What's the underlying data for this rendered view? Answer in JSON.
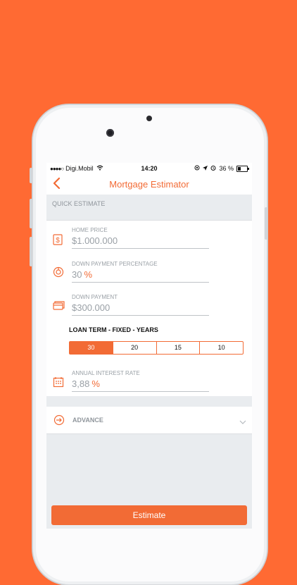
{
  "status": {
    "carrier": "Digi.Mobil",
    "time": "14:20",
    "battery": "36 %",
    "battery_level": 0.36
  },
  "nav": {
    "title": "Mortgage Estimator"
  },
  "quick_estimate": {
    "section_title": "QUICK ESTIMATE",
    "home_price": {
      "label": "HOME PRICE",
      "value": "$1.000.000"
    },
    "down_payment_percentage": {
      "label": "DOWN PAYMENT PERCENTAGE",
      "value": "30",
      "unit": "%"
    },
    "down_payment": {
      "label": "DOWN PAYMENT",
      "value": "$300.000"
    },
    "loan_term": {
      "title": "LOAN TERM - FIXED - YEARS",
      "options": [
        "30",
        "20",
        "15",
        "10"
      ],
      "selected": "30"
    },
    "interest_rate": {
      "label": "ANNUAL INTEREST RATE",
      "value": "3,88",
      "unit": "%"
    }
  },
  "advance": {
    "label": "ADVANCE"
  },
  "actions": {
    "estimate_label": "Estimate"
  },
  "colors": {
    "accent": "#F26B35",
    "background": "#FF6A33"
  }
}
